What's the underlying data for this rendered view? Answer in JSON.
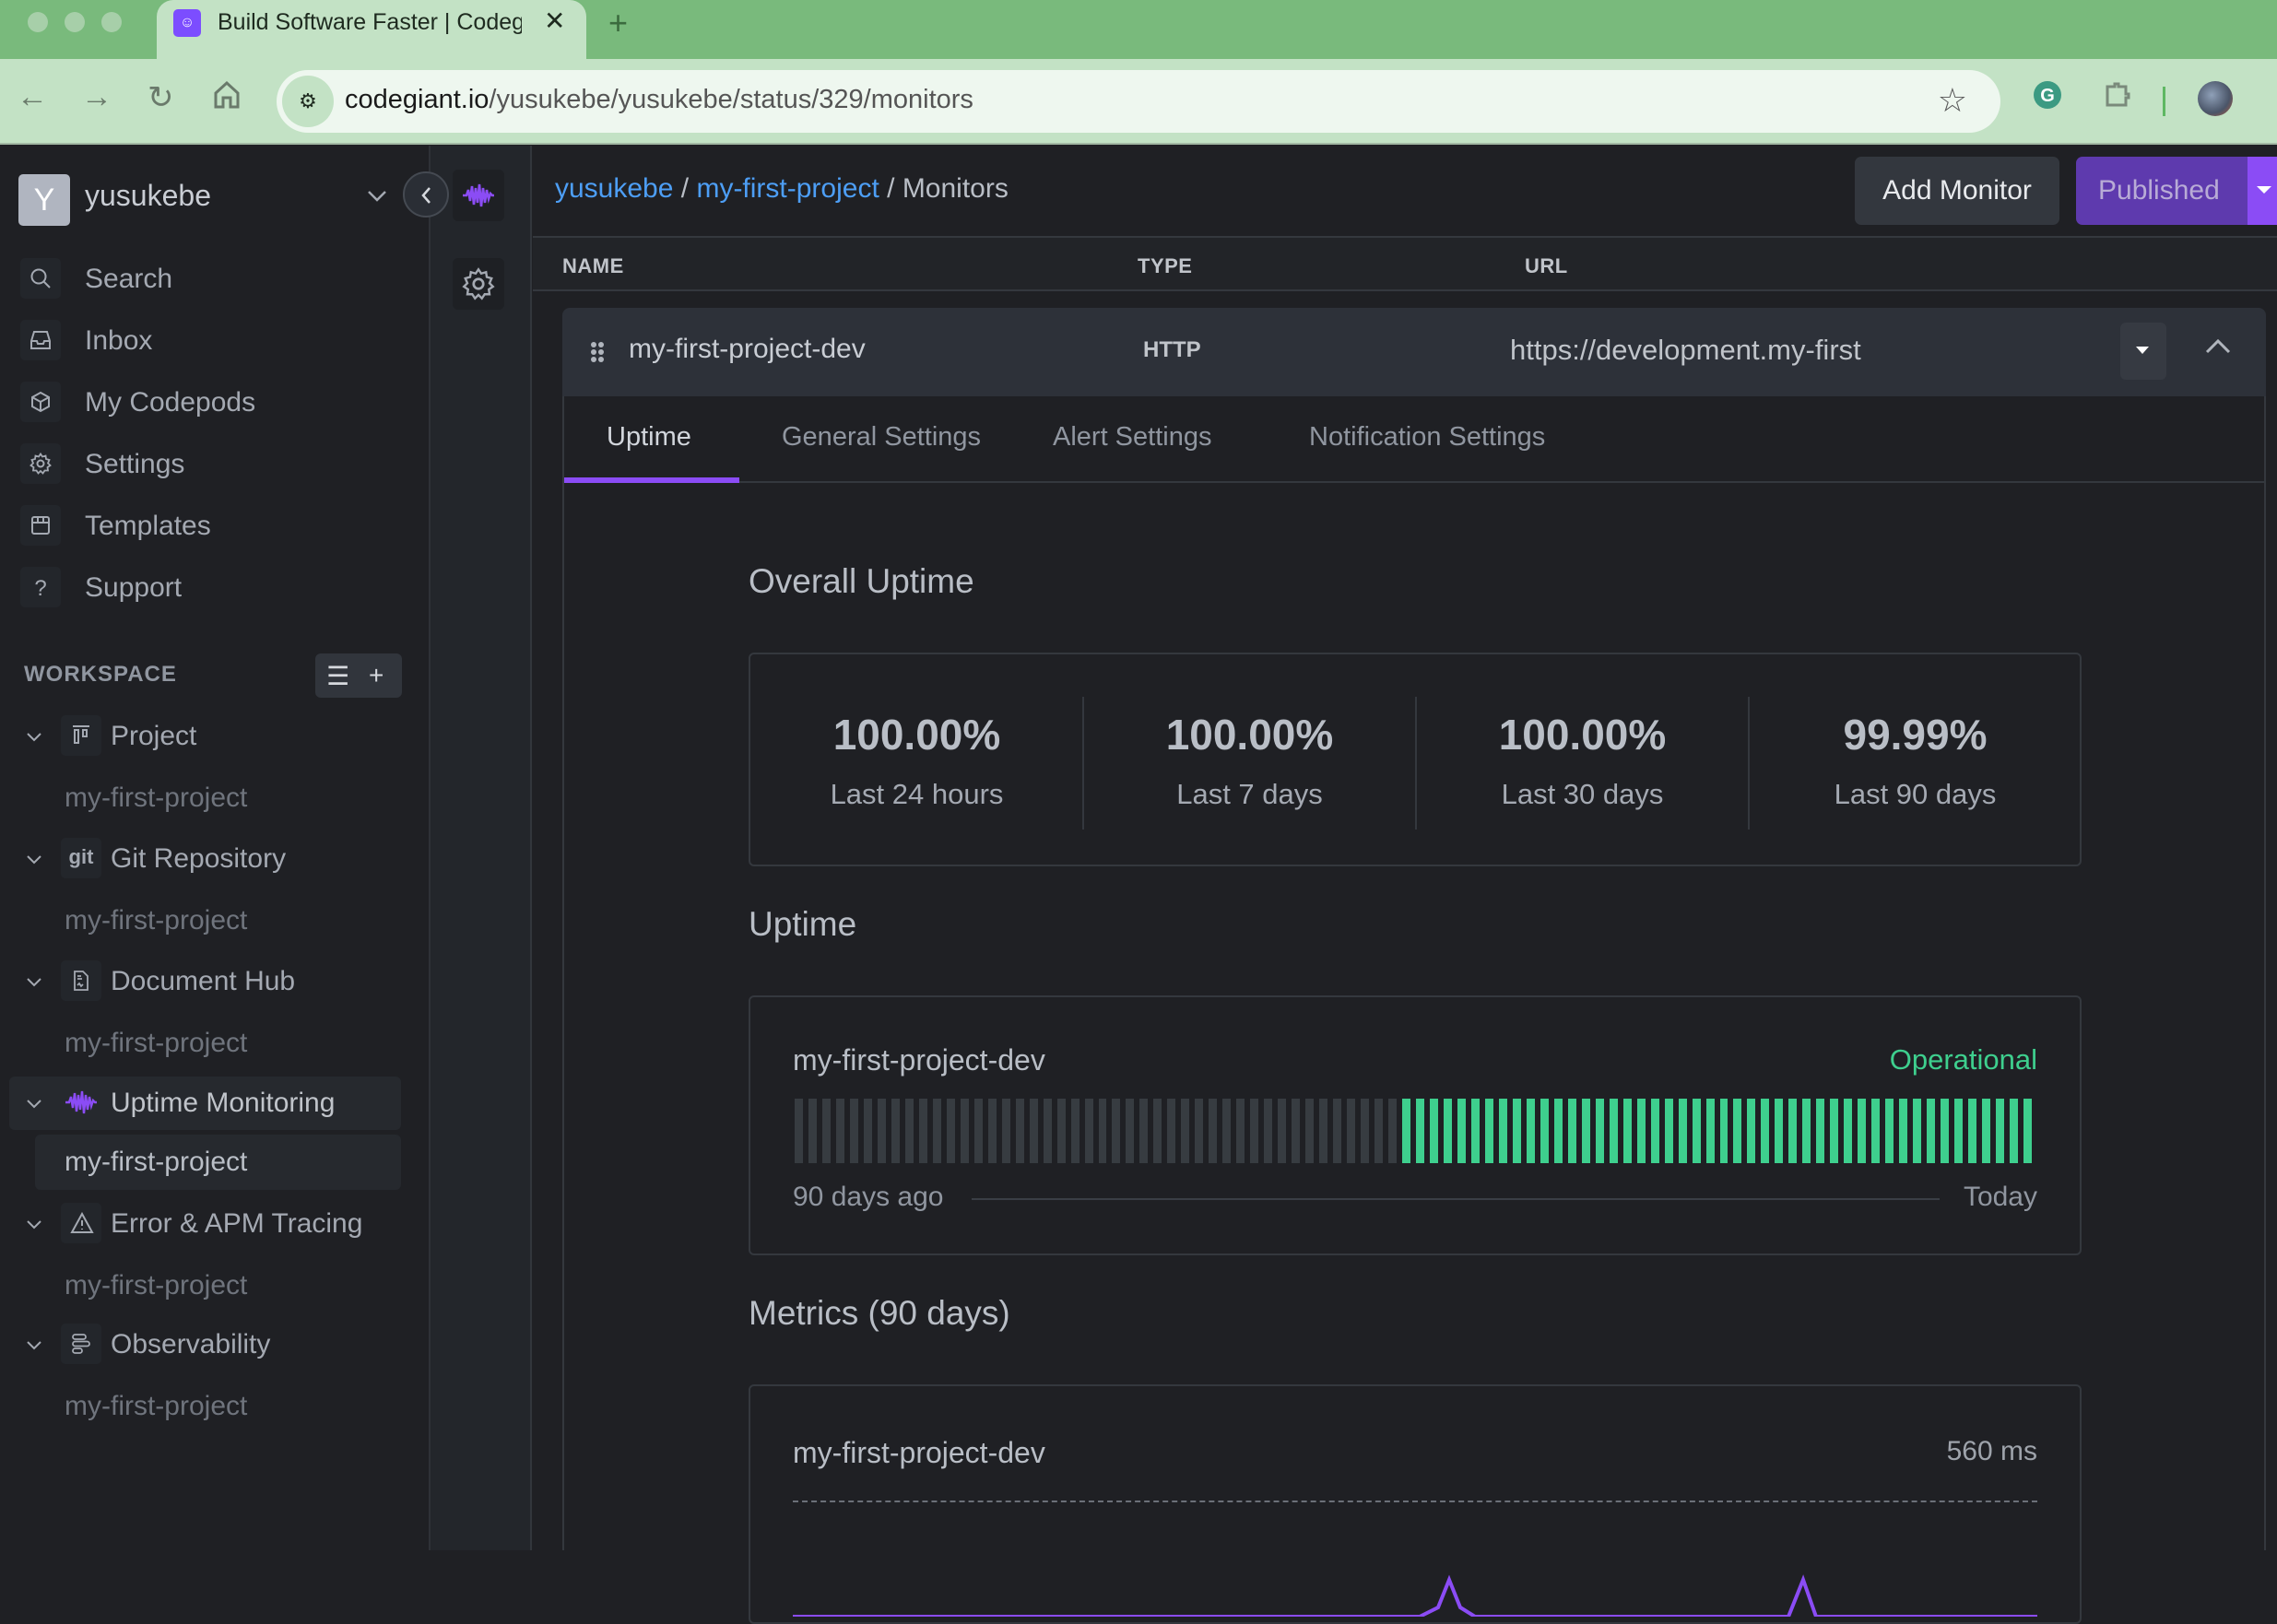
{
  "browser": {
    "tab_title": "Build Software Faster | Codeg",
    "url_host": "codegiant.io",
    "url_path": "/yusukebe/yusukebe/status/329/monitors"
  },
  "sidebar": {
    "workspace_initial": "Y",
    "workspace_name": "yusukebe",
    "nav": [
      {
        "label": "Search",
        "icon": "search-icon"
      },
      {
        "label": "Inbox",
        "icon": "inbox-icon"
      },
      {
        "label": "My Codepods",
        "icon": "cube-icon"
      },
      {
        "label": "Settings",
        "icon": "gear-icon"
      },
      {
        "label": "Templates",
        "icon": "template-icon"
      },
      {
        "label": "Support",
        "icon": "help-icon"
      }
    ],
    "workspace_header": "WORKSPACE",
    "tree": [
      {
        "label": "Project",
        "icon": "board-icon",
        "child": "my-first-project",
        "active": false
      },
      {
        "label": "Git Repository",
        "icon": "git-icon",
        "icon_text": "git",
        "child": "my-first-project",
        "active": false
      },
      {
        "label": "Document Hub",
        "icon": "document-icon",
        "child": "my-first-project",
        "active": false
      },
      {
        "label": "Uptime Monitoring",
        "icon": "pulse-icon",
        "child": "my-first-project",
        "active": true
      },
      {
        "label": "Error & APM Tracing",
        "icon": "warning-icon",
        "child": "my-first-project",
        "active": false
      },
      {
        "label": "Observability",
        "icon": "bars-icon",
        "child": "my-first-project",
        "active": false
      }
    ]
  },
  "header": {
    "breadcrumb": [
      {
        "label": "yusukebe",
        "link": true
      },
      {
        "label": "my-first-project",
        "link": true
      },
      {
        "label": "Monitors",
        "link": false
      }
    ],
    "add_monitor_label": "Add Monitor",
    "published_label": "Published"
  },
  "table": {
    "columns": [
      "NAME",
      "TYPE",
      "URL"
    ],
    "rows": [
      {
        "name": "my-first-project-dev",
        "type": "HTTP",
        "url": "https://development.my-first"
      }
    ]
  },
  "detail": {
    "tabs": [
      "Uptime",
      "General Settings",
      "Alert Settings",
      "Notification Settings"
    ],
    "active_tab": "Uptime",
    "overall_title": "Overall Uptime",
    "stats": [
      {
        "value": "100.00%",
        "label": "Last 24 hours"
      },
      {
        "value": "100.00%",
        "label": "Last 7 days"
      },
      {
        "value": "100.00%",
        "label": "Last 30 days"
      },
      {
        "value": "99.99%",
        "label": "Last 90 days"
      }
    ],
    "uptime_title": "Uptime",
    "uptime_card": {
      "name": "my-first-project-dev",
      "status": "Operational",
      "from_label": "90 days ago",
      "to_label": "Today",
      "days_total": 90,
      "days_no_data": 44,
      "days_up": 46,
      "colors": {
        "no_data": "#373c41",
        "up": "#3ecf8e"
      }
    },
    "metrics_title": "Metrics (90 days)",
    "metrics_card": {
      "name": "my-first-project-dev",
      "value": "560 ms"
    }
  },
  "colors": {
    "accent": "#8b4cf5",
    "link": "#4d9ef5",
    "operational": "#3ecf8e"
  }
}
